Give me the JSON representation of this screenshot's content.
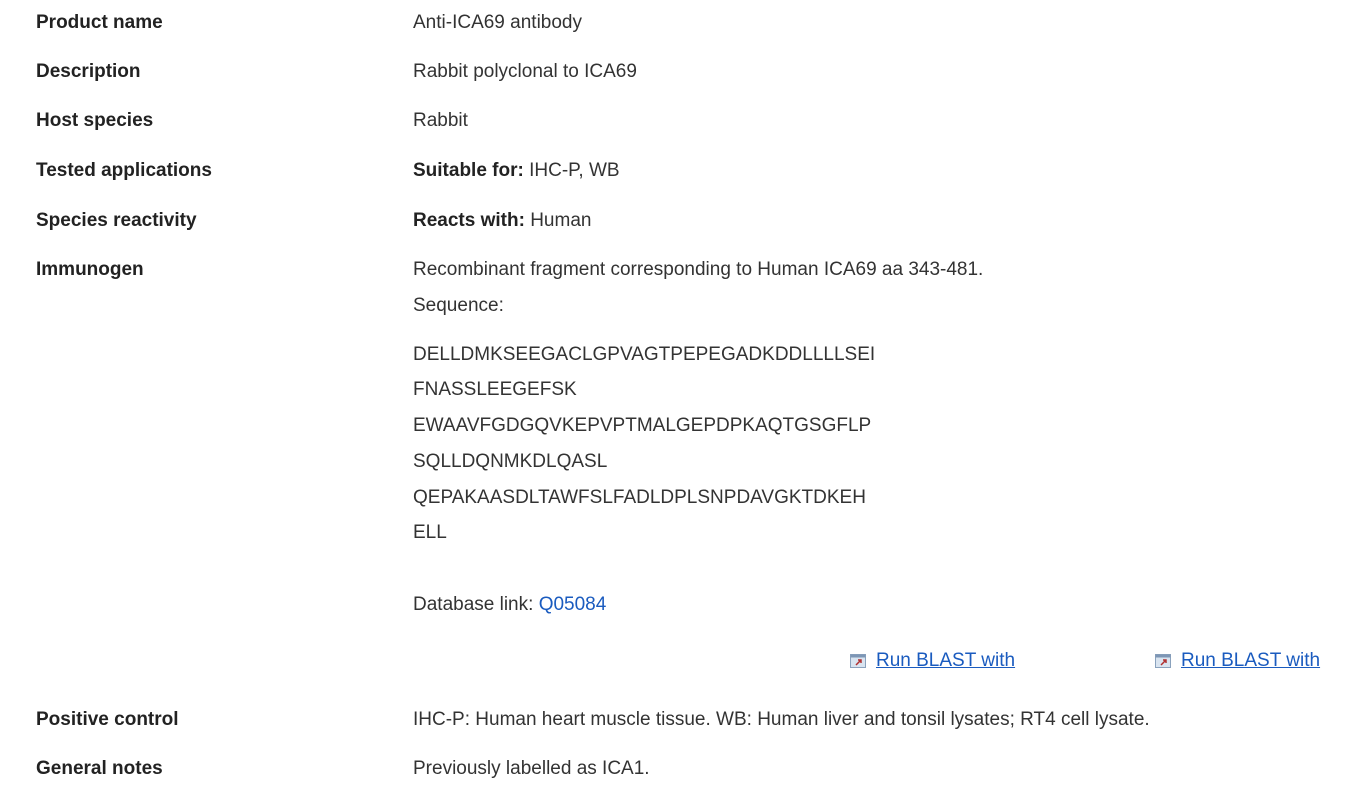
{
  "rows": {
    "product_name": {
      "label": "Product name",
      "value": "Anti-ICA69 antibody"
    },
    "description": {
      "label": "Description",
      "value": "Rabbit polyclonal to ICA69"
    },
    "host_species": {
      "label": "Host species",
      "value": "Rabbit"
    },
    "tested_applications": {
      "label": "Tested applications",
      "prefix": "Suitable for:",
      "value": "IHC-P, WB"
    },
    "species_reactivity": {
      "label": "Species reactivity",
      "prefix": "Reacts with:",
      "value": "Human"
    },
    "immunogen": {
      "label": "Immunogen",
      "value": "Recombinant fragment corresponding to Human ICA69 aa 343-481.",
      "sequence_label": "Sequence:",
      "sequence_lines": [
        "DELLDMKSEEGACLGPVAGTPEPEGADKDDLLLLSEI",
        "FNASSLEEGEFSK",
        "EWAAVFGDGQVKEPVPTMALGEPDPKAQTGSGFLP",
        "SQLLDQNMKDLQASL",
        "QEPAKAASDLTAWFSLFADLDPLSNPDAVGKTDKEH",
        "ELL"
      ],
      "database_label": "Database link:",
      "database_id": "Q05084",
      "blast_1": "Run BLAST with",
      "blast_2": "Run BLAST with"
    },
    "positive_control": {
      "label": "Positive control",
      "value": "IHC-P: Human heart muscle tissue. WB: Human liver and tonsil lysates; RT4 cell lysate."
    },
    "general_notes": {
      "label": "General notes",
      "value": "Previously labelled as ICA1."
    }
  },
  "colors": {
    "link": "#1a5bbf",
    "text": "#333333",
    "label": "#222222"
  },
  "icons": {
    "blast": "external-link-icon"
  }
}
